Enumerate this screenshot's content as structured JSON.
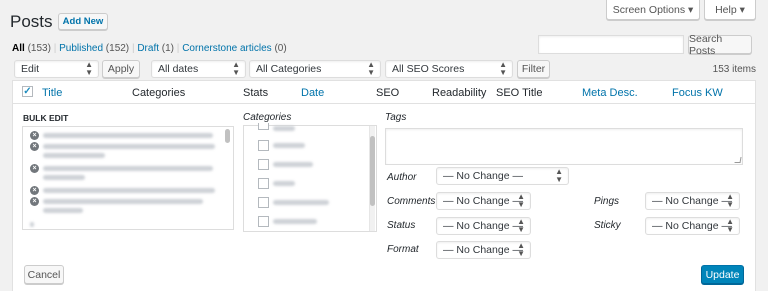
{
  "header": {
    "title": "Posts",
    "add_new": "Add New",
    "screen_options": "Screen Options ▾",
    "help": "Help ▾"
  },
  "subsubsub": {
    "all": "All",
    "all_count": "(153)",
    "sep": "|",
    "published": "Published",
    "published_count": "(152)",
    "draft": "Draft",
    "draft_count": "(1)",
    "cornerstone": "Cornerstone articles",
    "cornerstone_count": "(0)"
  },
  "search": {
    "button": "Search Posts",
    "value": ""
  },
  "tablenav": {
    "bulk_action": "Edit",
    "apply": "Apply",
    "dates": "All dates",
    "categories": "All Categories",
    "seo_scores": "All SEO Scores",
    "filter": "Filter",
    "items": "153 items"
  },
  "columns": {
    "title": "Title",
    "categories": "Categories",
    "stats": "Stats",
    "date": "Date",
    "seo": "SEO",
    "readability": "Readability",
    "seo_title": "SEO Title",
    "meta_desc": "Meta Desc.",
    "focus_kw": "Focus KW"
  },
  "bulk_edit": {
    "heading": "BULK EDIT",
    "categories_label": "Categories",
    "tags_label": "Tags",
    "author_label": "Author",
    "author_value": "— No Change —",
    "comments_label": "Comments",
    "comments_value": "— No Change —",
    "status_label": "Status",
    "status_value": "— No Change —",
    "format_label": "Format",
    "format_value": "— No Change —",
    "pings_label": "Pings",
    "pings_value": "— No Change —",
    "sticky_label": "Sticky",
    "sticky_value": "— No Change —",
    "cancel": "Cancel",
    "update": "Update",
    "remove_icon": "x-circle-icon"
  },
  "colors": {
    "link": "#0073aa",
    "primary": "#0085ba",
    "background": "#f1f1f1",
    "panel": "#ffffff"
  }
}
